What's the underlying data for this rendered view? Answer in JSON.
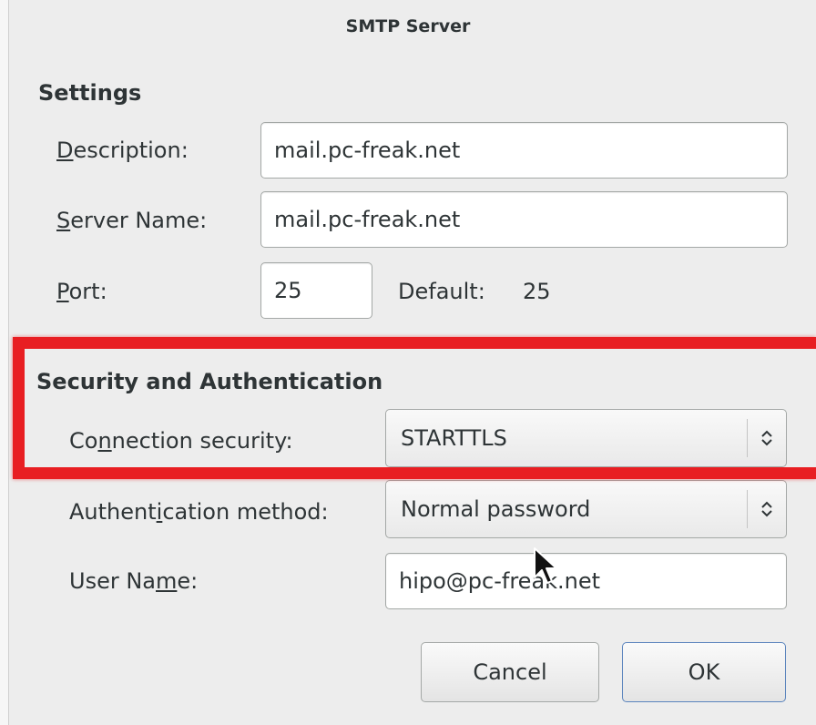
{
  "dialog": {
    "title": "SMTP Server"
  },
  "settings": {
    "heading": "Settings",
    "description": {
      "label_mnemonic": "D",
      "label_rest": "escription:",
      "value": "mail.pc-freak.net"
    },
    "server_name": {
      "label_mnemonic": "S",
      "label_rest": "erver Name:",
      "value": "mail.pc-freak.net"
    },
    "port": {
      "label_mnemonic": "P",
      "label_rest": "ort:",
      "value": "25",
      "default_label": "Default:",
      "default_value": "25"
    }
  },
  "security": {
    "heading": "Security and Authentication",
    "connection_security": {
      "label_pre": "Co",
      "label_mnemonic": "n",
      "label_post": "nection security:",
      "selected": "STARTTLS"
    },
    "auth_method": {
      "label_pre": "Authent",
      "label_mnemonic": "i",
      "label_post": "cation method:",
      "selected": "Normal password"
    },
    "user_name": {
      "label_pre": "User Na",
      "label_mnemonic": "m",
      "label_post": "e:",
      "value": "hipo@pc-freak.net"
    }
  },
  "buttons": {
    "cancel": "Cancel",
    "ok": "OK"
  },
  "icons": {
    "combo_arrows": "up-down-chevron-icon",
    "cursor": "mouse-pointer-icon"
  },
  "colors": {
    "highlight": "#e81e22",
    "default_button_border": "#5b84bd"
  }
}
